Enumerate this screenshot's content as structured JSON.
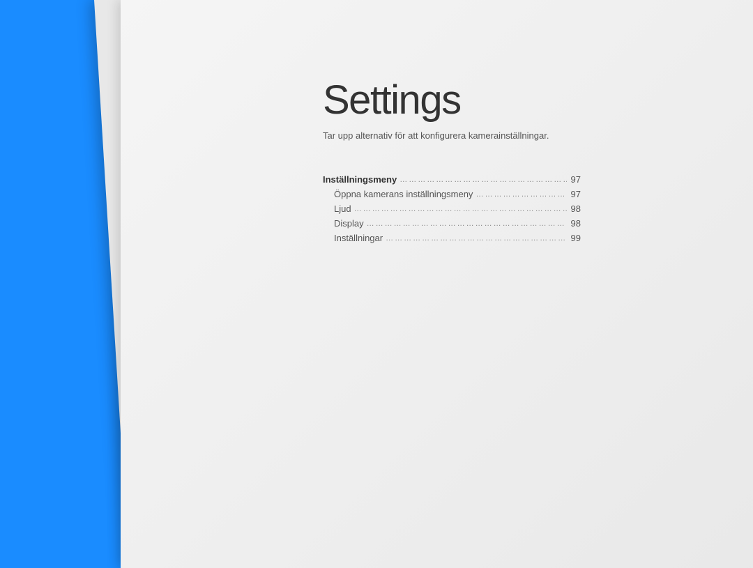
{
  "title": "Settings",
  "subtitle": "Tar upp alternativ för att konfigurera kamerainställningar.",
  "toc": [
    {
      "label": "Inställningsmeny",
      "page": "97",
      "level": 0
    },
    {
      "label": "Öppna kamerans inställningsmeny",
      "page": "97",
      "level": 1
    },
    {
      "label": "Ljud",
      "page": "98",
      "level": 1
    },
    {
      "label": "Display",
      "page": "98",
      "level": 1
    },
    {
      "label": "Inställningar",
      "page": "99",
      "level": 1
    }
  ]
}
